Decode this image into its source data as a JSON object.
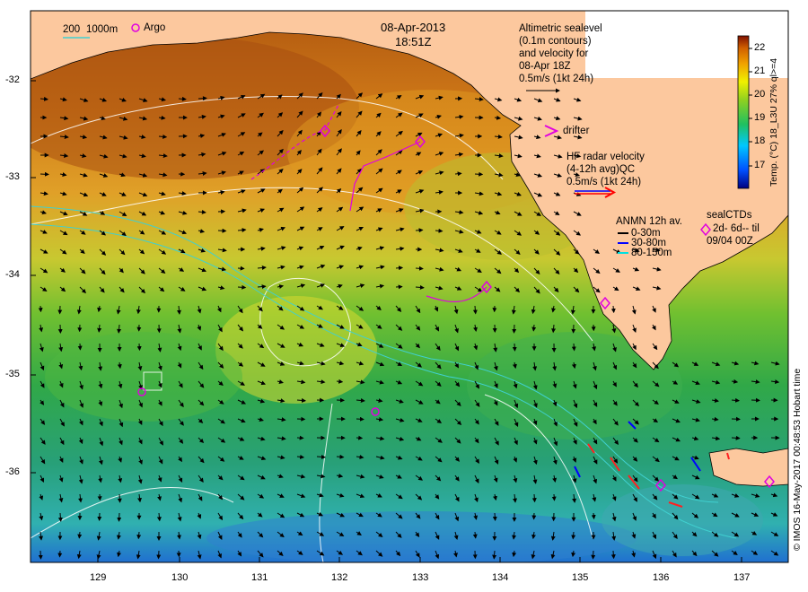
{
  "header": {
    "date": "08-Apr-2013",
    "time": "18:51Z"
  },
  "scale_legend": {
    "contour_200": "200",
    "contour_1000": "1000m",
    "argo": "Argo"
  },
  "altimetry_note": {
    "lines": [
      "Altimetric sealevel",
      "(0.1m contours)",
      "and velocity for",
      "08-Apr 18Z",
      "0.5m/s (1kt 24h)"
    ]
  },
  "drifter_label": "drifter",
  "hf_radar": {
    "lines": [
      "HF radar velocity",
      "(4-12h avg)QC",
      "0.5m/s (1kt 24h)"
    ]
  },
  "anmn": {
    "title": "ANMN 12h av.",
    "items": [
      {
        "label": "0-30m",
        "color": "#000000"
      },
      {
        "label": "30-80m",
        "color": "#0000ff"
      },
      {
        "label": "80-150m",
        "color": "#00e0e0"
      }
    ]
  },
  "sealctds": {
    "title": "sealCTDs",
    "line1": "2d- 6d-- til",
    "line2": "09/04 00Z"
  },
  "colorbar": {
    "ticks": [
      "22",
      "21",
      "20",
      "19",
      "18",
      "17"
    ],
    "label": "Temp. (°C) 18_L3U 27% ql>=4",
    "min": 16.3,
    "max": 22.6
  },
  "axes": {
    "lat_ticks": [
      "-32",
      "-33",
      "-34",
      "-35",
      "-36"
    ],
    "lon_ticks": [
      "129",
      "130",
      "131",
      "132",
      "133",
      "134",
      "135",
      "136",
      "137"
    ]
  },
  "credit": "© IMOS 16-May-2017 00:48:53 Hobart time",
  "colors": {
    "land": "#fcc89e",
    "argo": "#e000e0",
    "drifter": "#e000e0",
    "hf_radar": "#ff0000"
  }
}
